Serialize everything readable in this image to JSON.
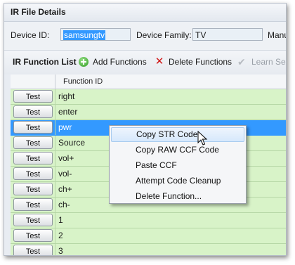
{
  "panel": {
    "title": "IR File Details"
  },
  "props": {
    "device_id_label": "Device ID:",
    "device_id_value": "samsungtv",
    "device_family_label": "Device Family:",
    "device_family_value": "TV",
    "manufacturer_label": "Manu"
  },
  "toolbar": {
    "title": "IR Function List",
    "add_label": "Add Functions",
    "add_icon": "add-circle-icon",
    "delete_label": "Delete Functions",
    "delete_icon": "red-x-icon",
    "learn_label": "Learn Se",
    "learn_icon": "checkmark-icon"
  },
  "grid": {
    "column_header": "Function ID",
    "button_label": "Test",
    "rows": [
      {
        "id": "right"
      },
      {
        "id": "enter"
      },
      {
        "id": "pwr",
        "selected": true
      },
      {
        "id": "Source"
      },
      {
        "id": "vol+"
      },
      {
        "id": "vol-"
      },
      {
        "id": "ch+"
      },
      {
        "id": "ch-"
      },
      {
        "id": "1"
      },
      {
        "id": "2"
      },
      {
        "id": "3"
      }
    ]
  },
  "context_menu": {
    "items": [
      "Copy STR Code",
      "Copy RAW CCF Code",
      "Paste CCF",
      "Attempt Code Cleanup",
      "Delete Function..."
    ],
    "hover_index": 0
  },
  "colors": {
    "row_bg": "#d8f3c8",
    "selected_bg": "#3399ff",
    "menu_hover": "#d6e8fc"
  }
}
